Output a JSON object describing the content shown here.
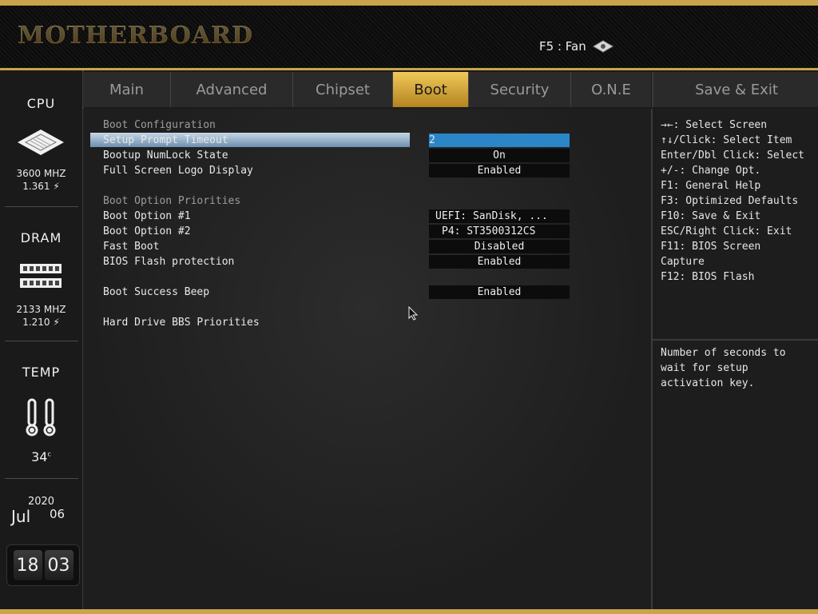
{
  "header": {
    "brand": "MOTHERBOARD",
    "fan_hint": "F5 : Fan"
  },
  "sidebar": {
    "cpu": {
      "title": "CPU",
      "freq": "3600 MHZ",
      "volt": "1.361 ⚡"
    },
    "dram": {
      "title": "DRAM",
      "freq": "2133 MHZ",
      "volt": "1.210 ⚡"
    },
    "temp": {
      "title": "TEMP",
      "value": "34",
      "unit": "c"
    },
    "date": {
      "year": "2020",
      "month": "Jul",
      "day": "06"
    },
    "clock": {
      "hours": "18",
      "minutes": "03"
    }
  },
  "tabs": [
    {
      "label": "Main",
      "active": false
    },
    {
      "label": "Advanced",
      "active": false
    },
    {
      "label": "Chipset",
      "active": false
    },
    {
      "label": "Boot",
      "active": true
    },
    {
      "label": "Security",
      "active": false
    },
    {
      "label": "O.N.E",
      "active": false
    }
  ],
  "save_exit_label": "Save & Exit",
  "main": {
    "section_boot_config": "Boot Configuration",
    "setup_prompt_label": "Setup Prompt Timeout",
    "setup_prompt_value": "2",
    "numlock_label": "Bootup NumLock State",
    "numlock_value": "On",
    "logo_label": "Full Screen Logo Display",
    "logo_value": "Enabled",
    "section_priorities": "Boot Option Priorities",
    "opt1_label": "Boot Option #1",
    "opt1_value": "UEFI: SanDisk, ...",
    "opt2_label": "Boot Option #2",
    "opt2_value": "P4: ST3500312CS",
    "fastboot_label": "Fast Boot",
    "fastboot_value": "Disabled",
    "flash_label": "BIOS Flash protection",
    "flash_value": "Enabled",
    "beep_label": "Boot Success Beep",
    "beep_value": "Enabled",
    "bbs_label": "Hard Drive BBS Priorities"
  },
  "help": {
    "keys": [
      "→←: Select Screen",
      "↑↓/Click: Select Item",
      "Enter/Dbl Click: Select",
      "+/-: Change Opt.",
      "F1: General Help",
      "F3: Optimized Defaults",
      "F10: Save & Exit",
      "ESC/Right Click: Exit",
      "F11: BIOS Screen",
      "Capture",
      "F12: BIOS Flash"
    ],
    "description": [
      "Number of seconds to",
      "wait for setup",
      "activation key."
    ]
  },
  "colors": {
    "gold": "#c9a44a",
    "selected_value": "#2b86c8",
    "highlight": "#9bb6d0"
  }
}
